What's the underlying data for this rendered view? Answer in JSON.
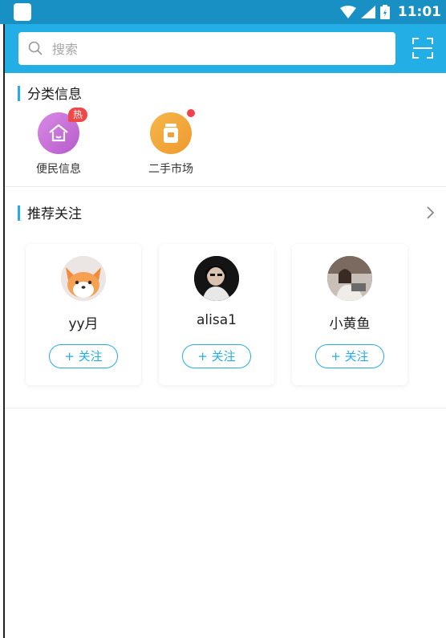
{
  "status_bar": {
    "time": "11:01"
  },
  "search": {
    "placeholder": "搜索"
  },
  "categories": {
    "title": "分类信息",
    "items": [
      {
        "label": "便民信息",
        "badge": "热",
        "color": "#c56fd6"
      },
      {
        "label": "二手市场",
        "dot": true,
        "color": "#f2a43a"
      }
    ]
  },
  "recommend": {
    "title": "推荐关注",
    "follow_label": "+ 关注",
    "users": [
      {
        "name": "yy月"
      },
      {
        "name": "alisa1"
      },
      {
        "name": "小黄鱼"
      }
    ]
  },
  "colors": {
    "accent": "#23aee6",
    "status_bar": "#1990c4",
    "hot": "#f04848"
  },
  "icons": [
    "search-icon",
    "scan-icon",
    "house-icon",
    "shop-icon",
    "chevron-right-icon",
    "wifi-icon",
    "signal-icon",
    "battery-icon"
  ]
}
